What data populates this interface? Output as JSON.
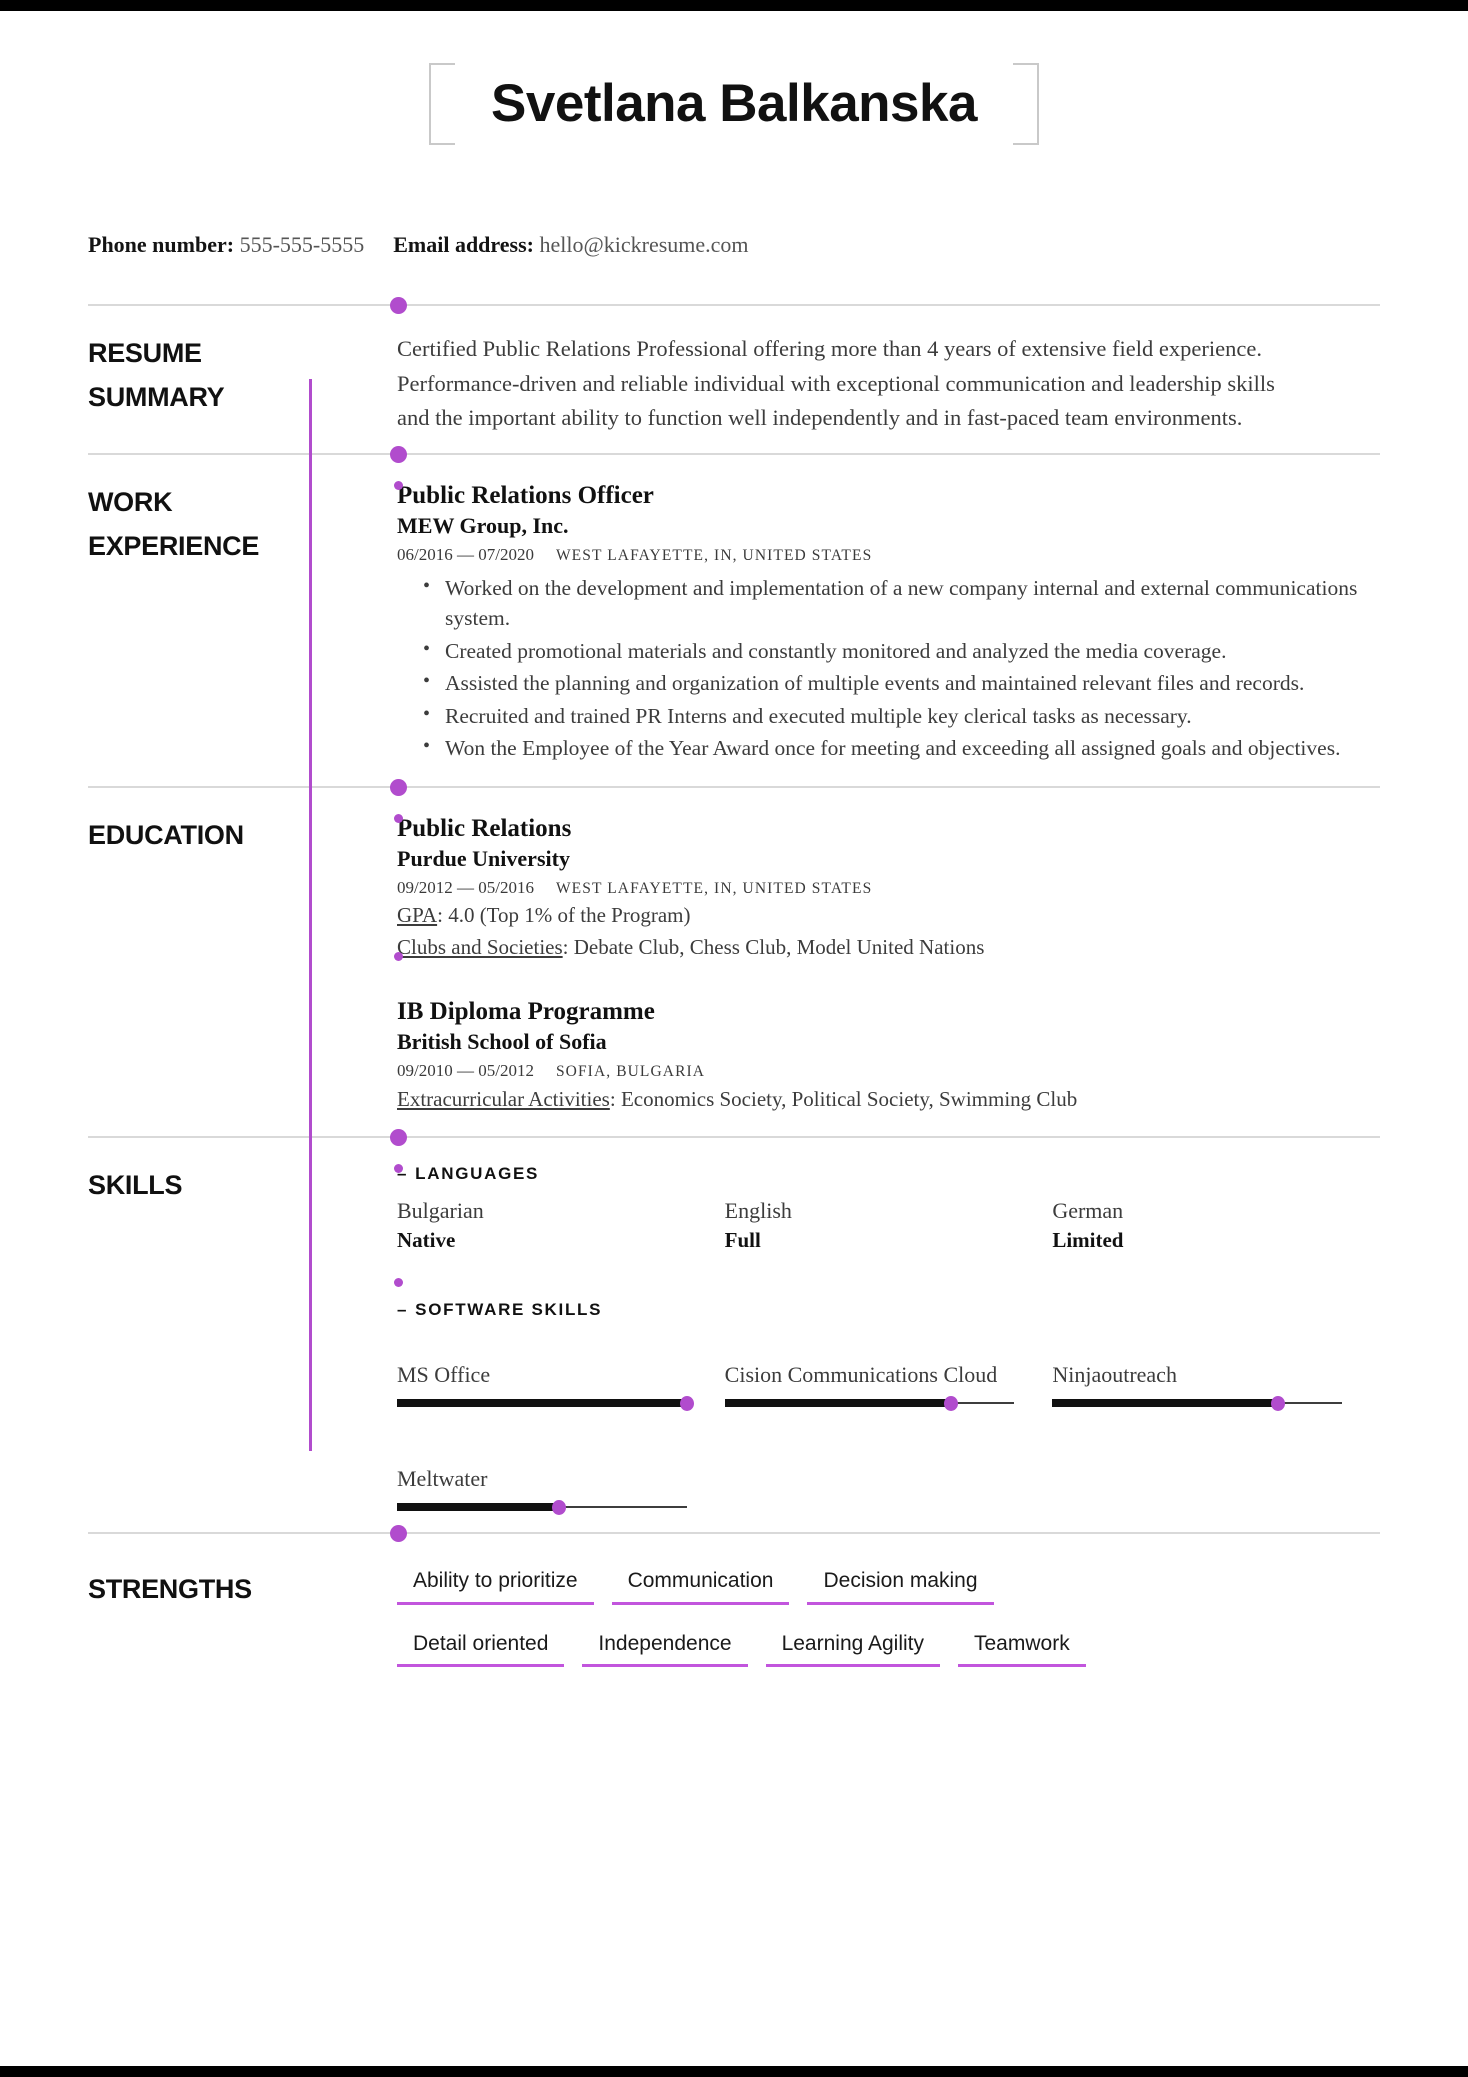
{
  "theme": {
    "accent": "#b14ccd",
    "chip_underline": "#c255dd",
    "bar_fill": "#111111",
    "divider": "#d9d9d9"
  },
  "header": {
    "full_name": "Svetlana Balkanska"
  },
  "contact": {
    "phone_label": "Phone number:",
    "phone_value": "555-555-5555",
    "email_label": "Email address:",
    "email_value": "hello@kickresume.com"
  },
  "sections": {
    "summary": {
      "title_line1": "RESUME",
      "title_line2": "SUMMARY",
      "text": "Certified Public Relations Professional offering more than 4 years of extensive field experience. Performance-driven and reliable individual with exceptional communication and leadership skills and the important ability to function well independently and in fast-paced team environments."
    },
    "work": {
      "title_line1": "WORK",
      "title_line2": "EXPERIENCE",
      "entries": [
        {
          "position": "Public Relations Officer",
          "company": "MEW Group, Inc.",
          "dates": "06/2016 — 07/2020",
          "location": "WEST LAFAYETTE, IN, UNITED STATES",
          "bullets": [
            "Worked on the development and implementation of a new company internal and external communications system.",
            "Created promotional materials and constantly monitored and analyzed the media coverage.",
            "Assisted the planning and organization of multiple events and maintained relevant files and records.",
            "Recruited and trained PR Interns and executed multiple key clerical tasks as necessary.",
            "Won the Employee of the Year Award once for meeting and exceeding all assigned goals and objectives."
          ]
        }
      ]
    },
    "education": {
      "title_line1": "EDUCATION",
      "entries": [
        {
          "program": "Public Relations",
          "school": "Purdue University",
          "dates": "09/2012 — 05/2016",
          "location": "WEST LAFAYETTE, IN, UNITED STATES",
          "notes": [
            {
              "label": "GPA",
              "value": "4.0 (Top 1% of the Program)"
            },
            {
              "label": "Clubs and Societies",
              "value": "Debate Club, Chess Club, Model United Nations"
            }
          ]
        },
        {
          "program": "IB Diploma Programme",
          "school": "British School of Sofia",
          "dates": "09/2010 — 05/2012",
          "location": "SOFIA, BULGARIA",
          "notes": [
            {
              "label": "Extracurricular Activities",
              "value": "Economics Society, Political Society, Swimming Club"
            }
          ]
        }
      ]
    },
    "skills": {
      "title_line1": "SKILLS",
      "languages_heading": "LANGUAGES",
      "languages": [
        {
          "name": "Bulgarian",
          "level": "Native"
        },
        {
          "name": "English",
          "level": "Full"
        },
        {
          "name": "German",
          "level": "Limited"
        }
      ],
      "software_heading": "SOFTWARE SKILLS",
      "software": [
        {
          "name": "MS Office",
          "percent": 100
        },
        {
          "name": "Cision Communications Cloud",
          "percent": 78
        },
        {
          "name": "Ninjaoutreach",
          "percent": 78
        },
        {
          "name": "Meltwater",
          "percent": 56
        }
      ]
    },
    "strengths": {
      "title_line1": "STRENGTHS",
      "rows": [
        [
          "Ability to prioritize",
          "Communication",
          "Decision making"
        ],
        [
          "Detail oriented",
          "Independence",
          "Learning Agility",
          "Teamwork"
        ]
      ]
    }
  }
}
